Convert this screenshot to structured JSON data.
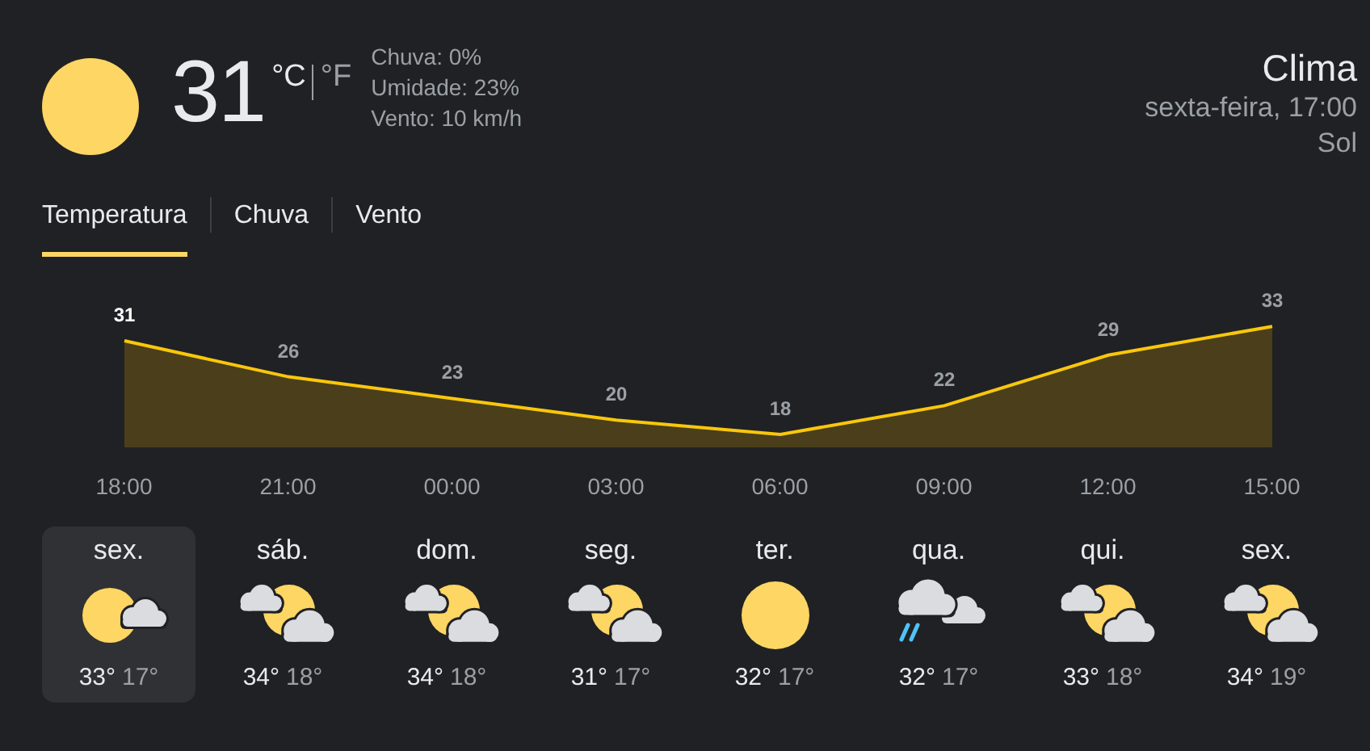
{
  "current": {
    "kind": "sun",
    "temperature": "31",
    "units": [
      {
        "label": "°C",
        "selected": true
      },
      {
        "label": "°F",
        "selected": false
      }
    ],
    "details": [
      "Chuva: 0%",
      "Umidade: 23%",
      "Vento: 10 km/h"
    ]
  },
  "header": {
    "title": "Clima",
    "datetime": "sexta-feira, 17:00",
    "condition": "Sol"
  },
  "tabs": [
    {
      "label": "Temperatura",
      "selected": true
    },
    {
      "label": "Chuva",
      "selected": false
    },
    {
      "label": "Vento",
      "selected": false
    }
  ],
  "chart": {
    "chart_data": {
      "type": "area",
      "categories": [
        "18:00",
        "21:00",
        "00:00",
        "03:00",
        "06:00",
        "09:00",
        "12:00",
        "15:00"
      ],
      "values": [
        31,
        26,
        23,
        20,
        18,
        22,
        29,
        33
      ],
      "data_labels": true
    }
  },
  "days": [
    {
      "day": "sex.",
      "kind": "sun_small_cloud",
      "high": "33°",
      "low": "17°",
      "selected": true
    },
    {
      "day": "sáb.",
      "kind": "partly_cloudy",
      "high": "34°",
      "low": "18°",
      "selected": false
    },
    {
      "day": "dom.",
      "kind": "partly_cloudy",
      "high": "34°",
      "low": "18°",
      "selected": false
    },
    {
      "day": "seg.",
      "kind": "partly_cloudy",
      "high": "31°",
      "low": "17°",
      "selected": false
    },
    {
      "day": "ter.",
      "kind": "sun",
      "high": "32°",
      "low": "17°",
      "selected": false
    },
    {
      "day": "qua.",
      "kind": "rain",
      "high": "32°",
      "low": "17°",
      "selected": false
    },
    {
      "day": "qui.",
      "kind": "partly_cloudy",
      "high": "33°",
      "low": "18°",
      "selected": false
    },
    {
      "day": "sex.",
      "kind": "partly_cloudy",
      "high": "34°",
      "low": "19°",
      "selected": false
    }
  ]
}
